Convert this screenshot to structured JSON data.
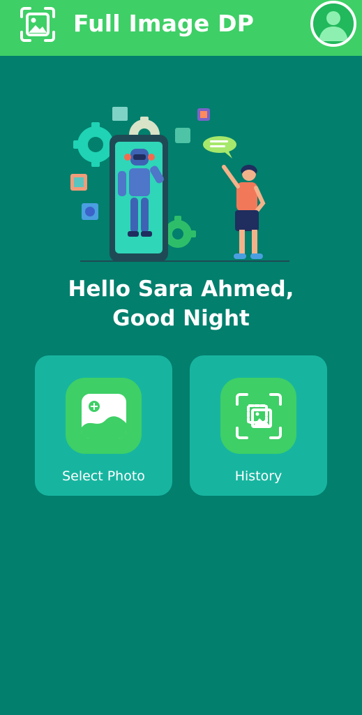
{
  "app_bar": {
    "title": "Full Image DP",
    "logo_icon": "image-scan-icon",
    "avatar_icon": "user-avatar-icon"
  },
  "hero": {
    "illustration": "robot-and-boy-illustration"
  },
  "greeting": {
    "line1": "Hello Sara Ahmed,",
    "line2": "Good Night"
  },
  "actions": {
    "select_photo": {
      "label": "Select Photo",
      "icon": "add-photo-icon"
    },
    "history": {
      "label": "History",
      "icon": "scan-image-icon"
    }
  },
  "colors": {
    "background": "#027F6D",
    "app_bar": "#3ECF66",
    "card": "#17B5A0",
    "icon_tile": "#3ECF66"
  }
}
